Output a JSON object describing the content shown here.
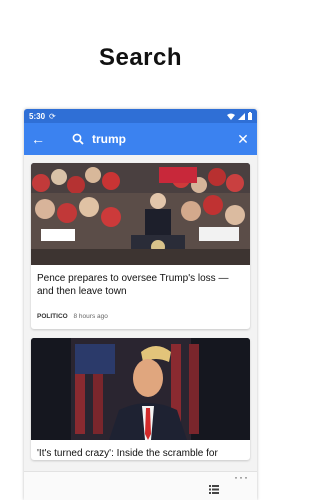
{
  "page": {
    "headline": "Search"
  },
  "status_bar": {
    "time": "5:30"
  },
  "app_bar": {
    "query": "trump"
  },
  "articles": [
    {
      "title": "Pence prepares to oversee Trump's loss — and then leave town",
      "source": "POLITICO",
      "time": "8 hours ago"
    },
    {
      "title": "'It's turned crazy': Inside the scramble for"
    }
  ],
  "colors": {
    "accent": "#3b82f0",
    "status_bar": "#2f6fd6"
  },
  "icons": [
    "back-arrow-icon",
    "search-icon",
    "close-icon",
    "list-icon",
    "more-icon"
  ]
}
